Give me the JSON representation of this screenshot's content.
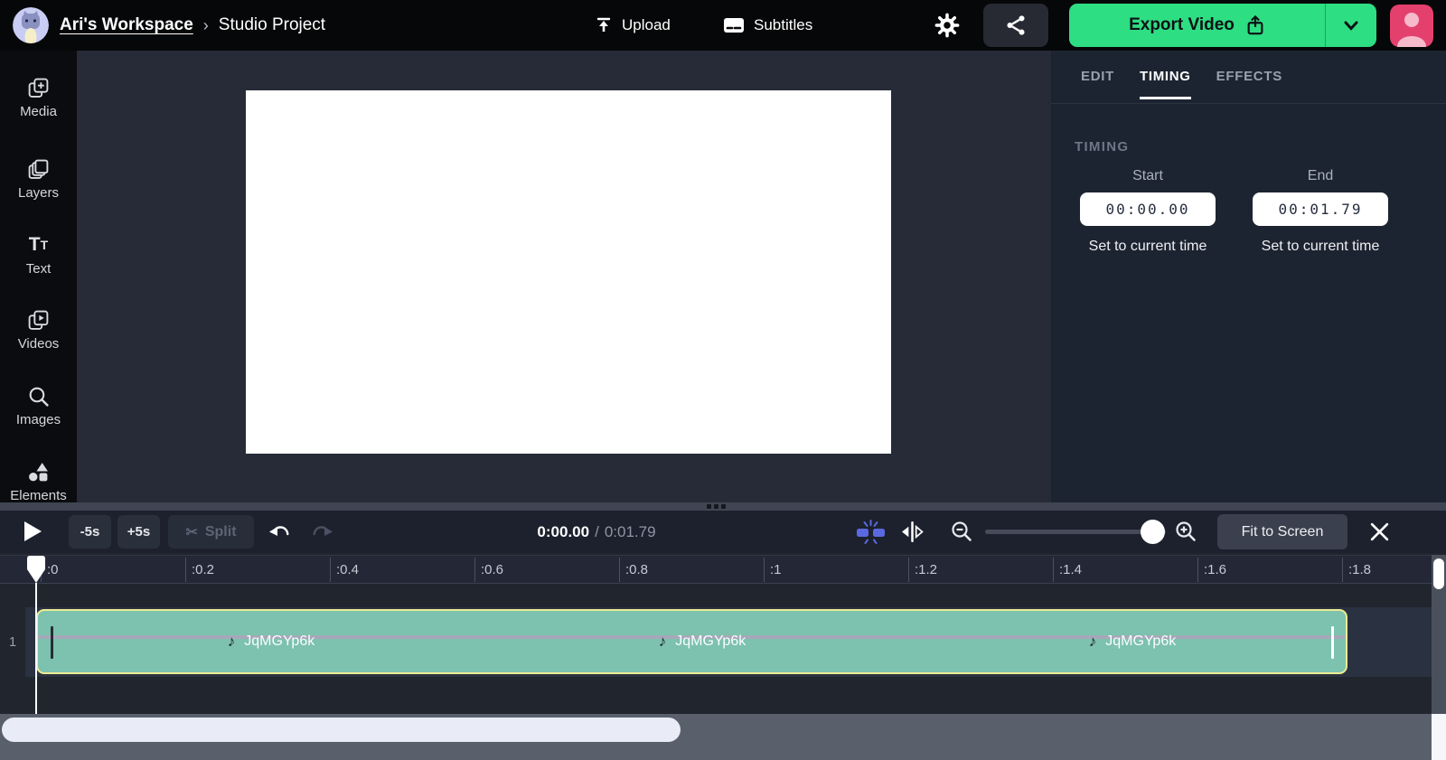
{
  "header": {
    "workspace_name": "Ari's Workspace",
    "breadcrumb_separator": "›",
    "project_name": "Studio Project",
    "upload_label": "Upload",
    "subtitles_label": "Subtitles",
    "export_label": "Export Video"
  },
  "sidebar": {
    "items": [
      {
        "label": "Media"
      },
      {
        "label": "Layers"
      },
      {
        "label": "Text"
      },
      {
        "label": "Videos"
      },
      {
        "label": "Images"
      },
      {
        "label": "Elements"
      }
    ]
  },
  "panel": {
    "tabs": [
      {
        "label": "EDIT",
        "active": false
      },
      {
        "label": "TIMING",
        "active": true
      },
      {
        "label": "EFFECTS",
        "active": false
      }
    ],
    "section_title": "TIMING",
    "start": {
      "label": "Start",
      "value": "00:00.00",
      "set_link": "Set to current time"
    },
    "end": {
      "label": "End",
      "value": "00:01.79",
      "set_link": "Set to current time"
    }
  },
  "toolbar": {
    "jump_back_label": "-5s",
    "jump_forward_label": "+5s",
    "split_label": "Split",
    "split_icon": "✂",
    "current_time": "0:00.00",
    "time_separator": "/",
    "total_time": "0:01.79",
    "fit_label": "Fit to Screen"
  },
  "timeline": {
    "track_number": "1",
    "music_note": "♪",
    "ruler_ticks": [
      ":0",
      ":0.2",
      ":0.4",
      ":0.6",
      ":0.8",
      ":1",
      ":1.2",
      ":1.4",
      ":1.6",
      ":1.8"
    ],
    "clip_labels": [
      "JqMGYp6k",
      "JqMGYp6k",
      "JqMGYp6k"
    ]
  },
  "colors": {
    "accent_green": "#2ede82",
    "snap_blue": "#5b69e0",
    "clip_fill": "#7cc2ae",
    "clip_border": "#eceb91",
    "avatar_pink": "#e4406e"
  }
}
